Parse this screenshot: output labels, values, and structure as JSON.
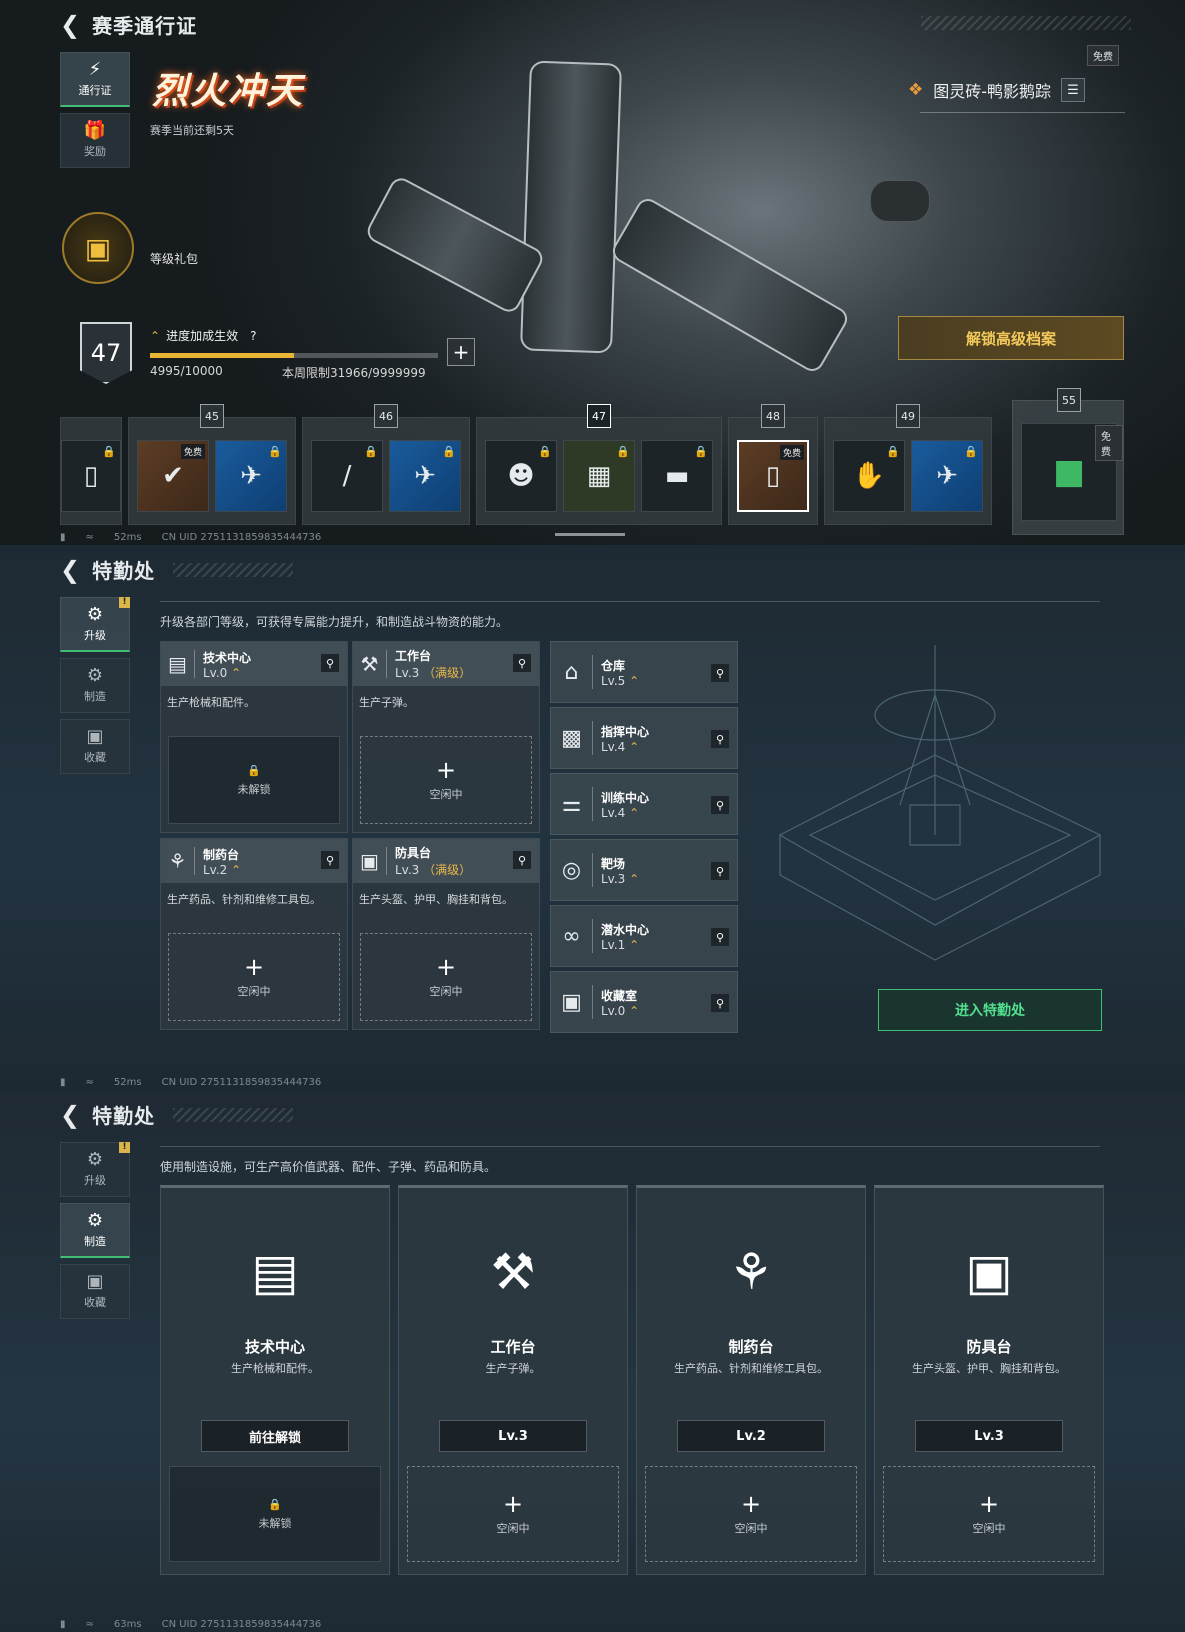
{
  "panel1": {
    "title": "赛季通行证",
    "nav": [
      {
        "label": "通行证",
        "icon": "pass-icon"
      },
      {
        "label": "奖励",
        "icon": "gift-icon"
      }
    ],
    "season_logo": "烈火冲天",
    "season_remaining": "赛季当前还剩5天",
    "free_tag": "免费",
    "map_name": "图灵砖-鸭影鹅踪",
    "gift_label": "等级礼包",
    "level": "47",
    "progress_label": "进度加成生效",
    "progress_help": "?",
    "progress_value": "4995/10000",
    "progress_fraction": 0.4995,
    "weekly_limit": "本周限制31966/9999999",
    "unlock_button": "解锁高级档案",
    "tiers": [
      {
        "num": "45",
        "items": [
          {
            "free": "免费",
            "claimed": true
          },
          {
            "locked": true
          }
        ]
      },
      {
        "num": "46",
        "items": [
          {
            "locked": true
          },
          {
            "locked": true
          }
        ]
      },
      {
        "num": "47",
        "items": [
          {
            "locked": true
          },
          {
            "locked": true
          },
          {
            "locked": true
          }
        ]
      },
      {
        "num": "48",
        "items": [
          {
            "free": "免费"
          }
        ]
      },
      {
        "num": "49",
        "items": [
          {
            "locked": true
          },
          {
            "locked": true
          }
        ]
      }
    ],
    "tier_last": {
      "num": "55",
      "free": "免费"
    },
    "status_ping": "52ms",
    "status_uid": "CN UID 2751131859835444736"
  },
  "panel2": {
    "title": "特勤处",
    "nav": [
      {
        "label": "升级",
        "icon": "upgrade-icon"
      },
      {
        "label": "制造",
        "icon": "craft-icon"
      },
      {
        "label": "收藏",
        "icon": "collection-icon"
      }
    ],
    "badge": "!",
    "description": "升级各部门等级，可获得专属能力提升，和制造战斗物资的能力。",
    "facilities": [
      {
        "name": "技术中心",
        "level": "Lv.0",
        "max": "",
        "desc": "生产枪械和配件。",
        "slot": "未解锁",
        "locked": true
      },
      {
        "name": "工作台",
        "level": "Lv.3",
        "max": "（满级）",
        "desc": "生产子弹。",
        "slot": "空闲中",
        "locked": false
      },
      {
        "name": "制药台",
        "level": "Lv.2",
        "max": "",
        "desc": "生产药品、针剂和维修工具包。",
        "slot": "空闲中",
        "locked": false
      },
      {
        "name": "防具台",
        "level": "Lv.3",
        "max": "（满级）",
        "desc": "生产头盔、护甲、胸挂和背包。",
        "slot": "空闲中",
        "locked": false
      }
    ],
    "side_facilities": [
      {
        "name": "仓库",
        "level": "Lv.5"
      },
      {
        "name": "指挥中心",
        "level": "Lv.4"
      },
      {
        "name": "训练中心",
        "level": "Lv.4"
      },
      {
        "name": "靶场",
        "level": "Lv.3"
      },
      {
        "name": "潜水中心",
        "level": "Lv.1"
      },
      {
        "name": "收藏室",
        "level": "Lv.0"
      }
    ],
    "enter_button": "进入特勤处",
    "status_ping": "52ms",
    "status_uid": "CN UID 2751131859835444736"
  },
  "panel3": {
    "title": "特勤处",
    "nav": [
      {
        "label": "升级"
      },
      {
        "label": "制造"
      },
      {
        "label": "收藏"
      }
    ],
    "badge": "!",
    "description": "使用制造设施，可生产高价值武器、配件、子弹、药品和防具。",
    "facilities": [
      {
        "name": "技术中心",
        "desc": "生产枪械和配件。",
        "button": "前往解锁",
        "slot": "未解锁",
        "locked": true
      },
      {
        "name": "工作台",
        "desc": "生产子弹。",
        "button": "Lv.3",
        "slot": "空闲中",
        "locked": false
      },
      {
        "name": "制药台",
        "desc": "生产药品、针剂和维修工具包。",
        "button": "Lv.2",
        "slot": "空闲中",
        "locked": false
      },
      {
        "name": "防具台",
        "desc": "生产头盔、护甲、胸挂和背包。",
        "button": "Lv.3",
        "slot": "空闲中",
        "locked": false
      }
    ],
    "status_ping": "63ms",
    "status_uid": "CN UID 2751131859835444736"
  }
}
